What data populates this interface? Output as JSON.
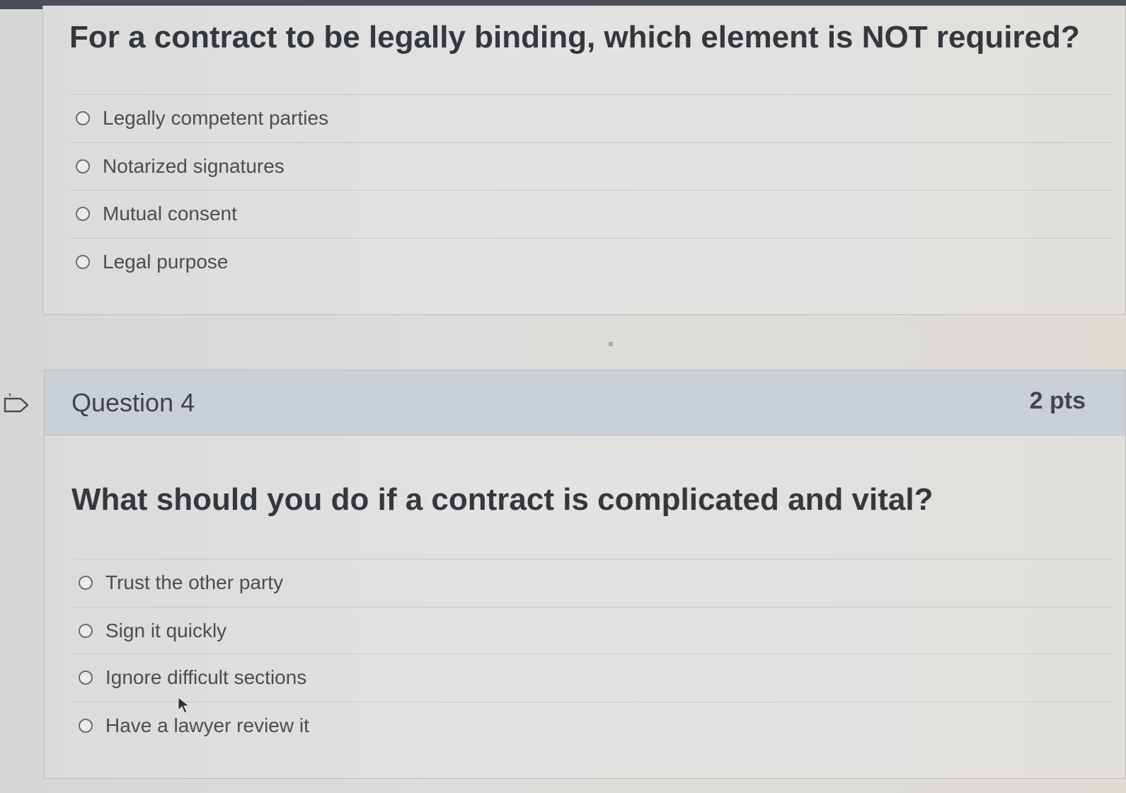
{
  "previous_question": {
    "text": "For a contract to be legally binding, which element is NOT required?",
    "answers": [
      {
        "label": "Legally competent parties"
      },
      {
        "label": "Notarized signatures"
      },
      {
        "label": "Mutual consent"
      },
      {
        "label": "Legal purpose"
      }
    ]
  },
  "question4": {
    "number": "Question 4",
    "points": "2 pts",
    "text": "What should you do if a contract is complicated and vital?",
    "answers": [
      {
        "label": "Trust the other party"
      },
      {
        "label": "Sign it quickly"
      },
      {
        "label": "Ignore difficult sections"
      },
      {
        "label": "Have a lawyer review it"
      }
    ]
  },
  "icons": {
    "flag": "flag-question-icon",
    "cursor": "mouse-cursor-icon"
  }
}
